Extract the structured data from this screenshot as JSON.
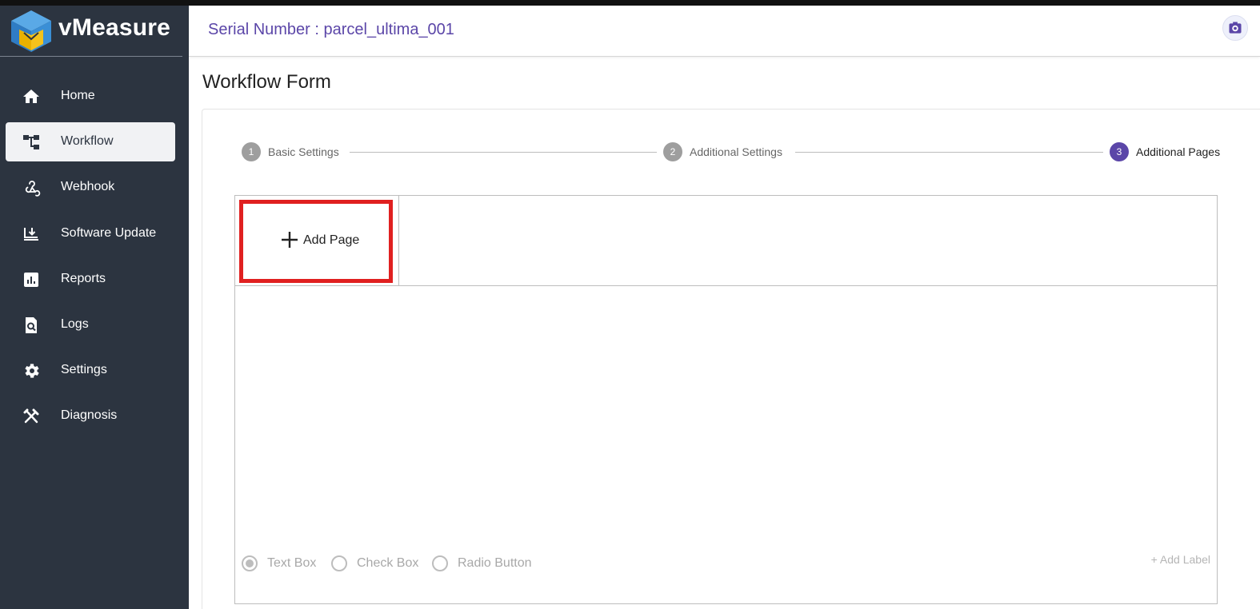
{
  "brand": {
    "name": "vMeasure"
  },
  "header": {
    "serial_text": "Serial Number : parcel_ultima_001"
  },
  "nav": [
    {
      "label": "Home",
      "icon": "home-icon",
      "active": false
    },
    {
      "label": "Workflow",
      "icon": "workflow-icon",
      "active": true
    },
    {
      "label": "Webhook",
      "icon": "webhook-icon",
      "active": false
    },
    {
      "label": "Software Update",
      "icon": "software-update-icon",
      "active": false
    },
    {
      "label": "Reports",
      "icon": "reports-icon",
      "active": false
    },
    {
      "label": "Logs",
      "icon": "logs-icon",
      "active": false
    },
    {
      "label": "Settings",
      "icon": "gear-icon",
      "active": false
    },
    {
      "label": "Diagnosis",
      "icon": "tools-icon",
      "active": false
    }
  ],
  "main": {
    "title": "Workflow Form",
    "steps": [
      {
        "number": "1",
        "label": "Basic Settings",
        "state": "complete"
      },
      {
        "number": "2",
        "label": "Additional Settings",
        "state": "complete"
      },
      {
        "number": "3",
        "label": "Additional Pages",
        "state": "active"
      }
    ],
    "add_page_label": "Add Page",
    "field_types": [
      {
        "label": "Text Box",
        "selected": true
      },
      {
        "label": "Check Box",
        "selected": false
      },
      {
        "label": "Radio Button",
        "selected": false
      }
    ],
    "add_label_link": "+ Add Label"
  },
  "colors": {
    "sidebar_bg": "#2c3440",
    "accent_purple": "#5b46a8",
    "highlight_red": "#e02020",
    "logo_blue": "#3a8fd6",
    "logo_yellow": "#f4c21b"
  }
}
